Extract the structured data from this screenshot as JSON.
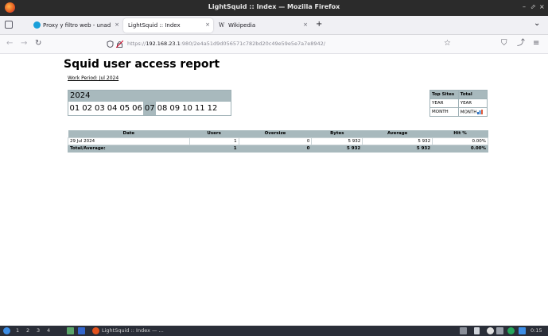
{
  "window": {
    "title": "LightSquid :: Index — Mozilla Firefox",
    "controls": [
      "–",
      "⬀",
      "×"
    ]
  },
  "tabs": [
    {
      "label": "Proxy y filtro web - unad",
      "icon": "chat-bubble-icon",
      "active": false
    },
    {
      "label": "LightSquid :: Index",
      "icon": "",
      "active": true
    },
    {
      "label": "Wikipedia",
      "icon": "wikipedia-icon",
      "active": false
    }
  ],
  "tabbar": {
    "new_tab": "+",
    "list_all": "⌄",
    "close": "×",
    "wiki_prefix": "W"
  },
  "navbar": {
    "back": "←",
    "forward": "→",
    "reload": "↻",
    "url_prefix": "https://",
    "url_host": "192.168.23.1",
    "url_rest": ":980/2e4a51d9d056571c782bd20c49e59e5e7a7e8942/",
    "bookmark_star": "☆",
    "pocket": "⛉",
    "extensions": "⤴",
    "menu": "≡"
  },
  "report": {
    "title": "Squid user access report",
    "work_period": "Work Period: Jul 2024",
    "year": "2024",
    "months": [
      "01",
      "02",
      "03",
      "04",
      "05",
      "06",
      "07",
      "08",
      "09",
      "10",
      "11",
      "12"
    ],
    "selected_month": "07",
    "top_sites": {
      "header_label": "Top Sites",
      "header_total": "Total",
      "row1_label": "YEAR",
      "row1_total": "YEAR",
      "row2_label": "MONTH",
      "row2_total": "MONTH"
    },
    "table": {
      "columns": [
        "Date",
        "Users",
        "Oversize",
        "Bytes",
        "Average",
        "Hit %"
      ],
      "rows": [
        {
          "date": "29 Jul 2024",
          "users": "1",
          "oversize": "0",
          "bytes": "5 932",
          "average": "5 932",
          "hit": "0.00%"
        }
      ],
      "total": {
        "label": "Total/Average:",
        "users": "1",
        "oversize": "0",
        "bytes": "5 932",
        "average": "5 932",
        "hit": "0.00%"
      }
    }
  },
  "taskbar": {
    "workspaces": [
      "1",
      "2",
      "3",
      "4"
    ],
    "active_window": "LightSquid :: Index — ...",
    "clock": "0:15"
  },
  "colors": {
    "header_bg": "#a8b9bd",
    "titlebar": "#2b2b2b",
    "taskbar": "#2a2e38"
  }
}
